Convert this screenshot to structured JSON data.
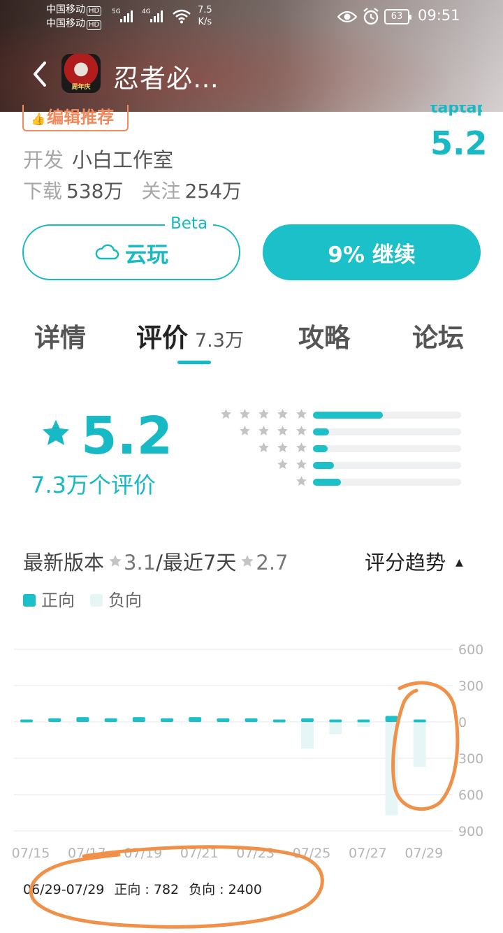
{
  "status_bar": {
    "carrier1": "中国移动",
    "carrier2": "中国移动",
    "hd": "HD",
    "net1": "5G",
    "net2": "4G",
    "speed_value": "7.5",
    "speed_unit": "K/s",
    "battery": "63",
    "time": "09:51"
  },
  "nav": {
    "title": "忍者必…",
    "app_icon_badge": "周年庆"
  },
  "info": {
    "tag": "编辑推荐",
    "brand_text": "taptap",
    "score": "5.2",
    "developer_label": "开发",
    "developer": "小白工作室",
    "downloads_label": "下载",
    "downloads": "538万",
    "follows_label": "关注",
    "follows": "254万"
  },
  "actions": {
    "cloud_play": "云玩",
    "beta": "Beta",
    "continue": "9% 继续"
  },
  "tabs": {
    "details": "详情",
    "reviews": "评价",
    "reviews_count": "7.3万",
    "guide": "攻略",
    "forum": "论坛"
  },
  "rating": {
    "score": "5.2",
    "count_text": "7.3万个评价",
    "distribution": [
      {
        "stars": 5,
        "fraction": 0.47
      },
      {
        "stars": 4,
        "fraction": 0.11
      },
      {
        "stars": 3,
        "fraction": 0.1
      },
      {
        "stars": 2,
        "fraction": 0.14
      },
      {
        "stars": 1,
        "fraction": 0.19
      }
    ]
  },
  "trend": {
    "latest_label": "最新版本",
    "latest_score": "3.1",
    "recent_label": "/最近7天",
    "recent_score": "2.7",
    "toggle_label": "评分趋势",
    "legend_positive": "正向",
    "legend_negative": "负向",
    "range_summary": {
      "range": "06/29-07/29",
      "positive": "正向 : 782",
      "negative": "负向 : 2400"
    }
  },
  "colors": {
    "accent": "#1cc0c8",
    "negative": "#e6f6f7",
    "tag": "#f08a5d",
    "annotation": "#f0914a"
  },
  "chart_data": {
    "type": "bar",
    "y_tick_labels": [
      "600",
      "300",
      "0",
      "300",
      "600",
      "900"
    ],
    "y_ticks": [
      600,
      300,
      0,
      -300,
      -600,
      -900
    ],
    "ylim": [
      -900,
      600
    ],
    "x_tick_labels": [
      "07/15",
      "07/17",
      "07/19",
      "07/21",
      "07/23",
      "07/25",
      "07/27",
      "07/29"
    ],
    "categories": [
      "07/15",
      "07/16",
      "07/17",
      "07/18",
      "07/19",
      "07/20",
      "07/21",
      "07/22",
      "07/23",
      "07/24",
      "07/25",
      "07/26",
      "07/27",
      "07/28",
      "07/29"
    ],
    "series": [
      {
        "name": "正向",
        "values": [
          20,
          30,
          40,
          30,
          40,
          30,
          40,
          30,
          30,
          20,
          30,
          20,
          20,
          50,
          20
        ]
      },
      {
        "name": "负向",
        "values": [
          0,
          0,
          0,
          0,
          0,
          0,
          0,
          0,
          0,
          0,
          -220,
          -100,
          -40,
          -770,
          -370
        ]
      }
    ]
  }
}
